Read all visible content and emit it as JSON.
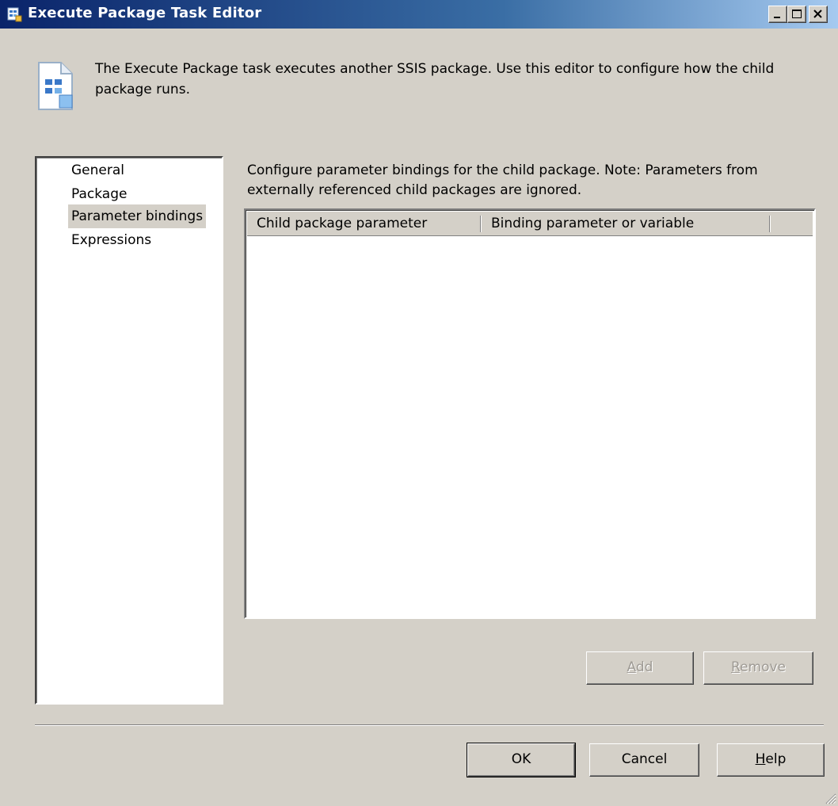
{
  "window": {
    "title": "Execute Package Task Editor",
    "controls": [
      "minimize",
      "maximize",
      "close"
    ]
  },
  "description": "The Execute Package task executes another SSIS package. Use this editor to configure how the child package runs.",
  "nav": {
    "items": [
      {
        "label": "General",
        "selected": false
      },
      {
        "label": "Package",
        "selected": false
      },
      {
        "label": "Parameter bindings",
        "selected": true
      },
      {
        "label": "Expressions",
        "selected": false
      }
    ]
  },
  "main": {
    "note": "Configure parameter bindings for the child package. Note: Parameters from externally referenced child packages are ignored.",
    "table": {
      "columns": [
        "Child package parameter",
        "Binding parameter or variable"
      ],
      "rows": []
    },
    "add_label_mnemonic": "A",
    "add_label_rest": "dd",
    "remove_label_mnemonic": "R",
    "remove_label_rest": "emove"
  },
  "footer": {
    "ok_label": "OK",
    "cancel_label": "Cancel",
    "help_label_mnemonic": "H",
    "help_label_rest": "elp"
  },
  "colors": {
    "face": "#d4d0c8",
    "title_start": "#0a246a",
    "title_end": "#a6caf0",
    "disabled_text": "#9e9a94"
  },
  "icons": {
    "title": "package-task-icon",
    "description": "package-document-icon",
    "resize": "resize-grip-icon"
  }
}
